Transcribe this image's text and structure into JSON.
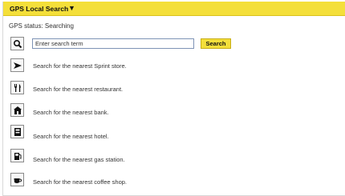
{
  "header": {
    "title": "GPS Local Search",
    "caret": "▼"
  },
  "status": {
    "text": "GPS status: Searching"
  },
  "search": {
    "placeholder": "Enter search term",
    "button_label": "Search"
  },
  "rows": [
    {
      "icon": "arrow-icon",
      "label": "Search for the nearest Sprint store."
    },
    {
      "icon": "fork-knife-icon",
      "label": "Search for the nearest restaurant."
    },
    {
      "icon": "bank-icon",
      "label": "Search for the nearest bank."
    },
    {
      "icon": "hotel-icon",
      "label": "Search for the nearest hotel."
    },
    {
      "icon": "gas-pump-icon",
      "label": "Search for the nearest gas station."
    },
    {
      "icon": "coffee-cup-icon",
      "label": "Search for the nearest coffee shop."
    }
  ],
  "colors": {
    "header": "#f4df3a",
    "button": "#f4df3a"
  }
}
